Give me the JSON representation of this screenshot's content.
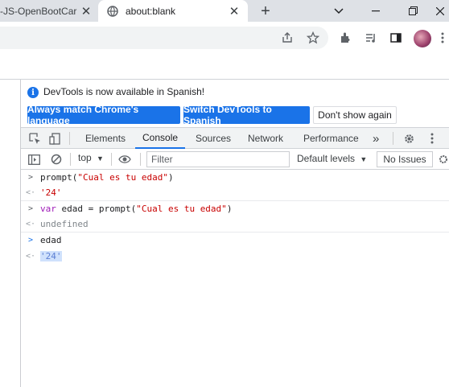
{
  "browser": {
    "tabs": [
      {
        "title": "-JS-OpenBootCar",
        "active": false
      },
      {
        "title": "about:blank",
        "active": true
      }
    ],
    "new_tab": "+"
  },
  "devtools": {
    "infobar": {
      "message": "DevTools is now available in Spanish!",
      "match_button": "Always match Chrome's language",
      "switch_button": "Switch DevTools to Spanish",
      "dismiss_button": "Don't show again"
    },
    "tabs": [
      "Elements",
      "Console",
      "Sources",
      "Network",
      "Performance"
    ],
    "more": "»",
    "selected_tab": "Console",
    "console_toolbar": {
      "context": "top",
      "filter_placeholder": "Filter",
      "levels": "Default levels",
      "issues": "No Issues"
    },
    "console": [
      {
        "type": "input",
        "text": "prompt(\"Cual es tu edad\")"
      },
      {
        "type": "result",
        "text": "'24'"
      },
      {
        "type": "input",
        "text": "var edad = prompt(\"Cual es tu edad\")"
      },
      {
        "type": "result",
        "text": "undefined"
      },
      {
        "type": "input",
        "text": "edad"
      },
      {
        "type": "result",
        "text": "'24'"
      }
    ]
  },
  "colors": {
    "accent": "#1a73e8",
    "string": "#c80000",
    "keyword": "#9f1bb8"
  }
}
